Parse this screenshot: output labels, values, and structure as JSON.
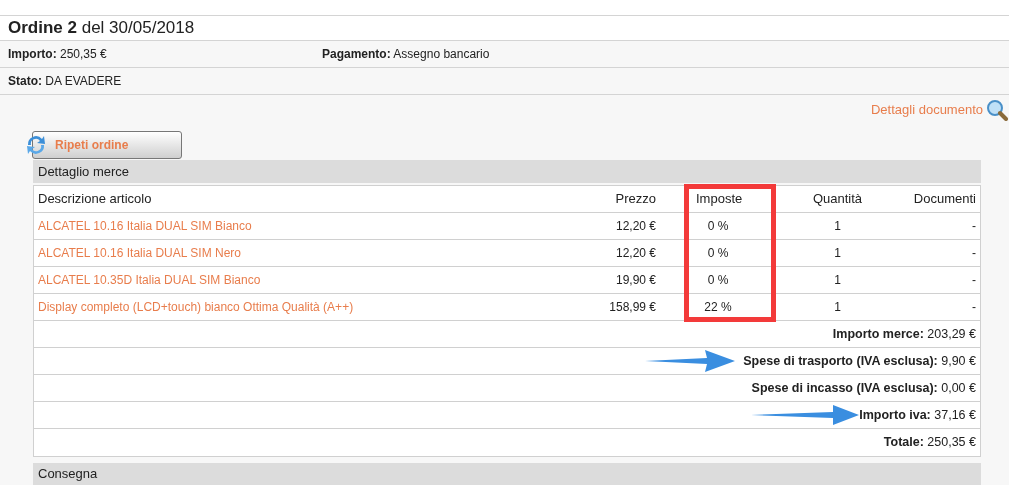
{
  "header": {
    "title": "Ordine 2",
    "date": "del 30/05/2018"
  },
  "info": [
    {
      "label": "Importo:",
      "value": "250,35 €"
    },
    {
      "label": "Pagamento:",
      "value": "Assegno bancario"
    },
    {
      "label": "Stato:",
      "value": "DA EVADERE"
    }
  ],
  "details_link": "Dettagli documento",
  "repeat_button": "Ripeti ordine",
  "section": "Dettaglio merce",
  "table": {
    "columns": [
      {
        "label": "Descrizione articolo",
        "highlighted": false
      },
      {
        "label": "Prezzo",
        "highlighted": false
      },
      {
        "label": "Imposte",
        "highlighted": true
      },
      {
        "label": "Quantità",
        "highlighted": false
      },
      {
        "label": "Documenti",
        "highlighted": false
      }
    ],
    "rows": [
      [
        "ALCATEL 10.16 Italia DUAL SIM Bianco",
        "12,20 €",
        "0 %",
        "1",
        "-"
      ],
      [
        "ALCATEL 10.16 Italia DUAL SIM Nero",
        "12,20 €",
        "0 %",
        "1",
        "-"
      ],
      [
        "ALCATEL 10.35D Italia DUAL SIM Bianco",
        "19,90 €",
        "0 %",
        "1",
        "-"
      ],
      [
        "Display completo (LCD+touch) bianco Ottima Qualità (A++)",
        "158,99 €",
        "22 %",
        "1",
        "-"
      ]
    ]
  },
  "summary": [
    {
      "label": "Importo merce:",
      "value": "203,29 €",
      "arrow": false
    },
    {
      "label": "Spese di trasporto (IVA esclusa):",
      "value": "9,90 €",
      "arrow": true
    },
    {
      "label": "Spese di incasso (IVA esclusa):",
      "value": "0,00 €",
      "arrow": false
    },
    {
      "label": "Importo iva:",
      "value": "37,16 €",
      "arrow": true
    },
    {
      "label": "Totale:",
      "value": "250,35 €",
      "arrow": false
    }
  ],
  "next_section": "Consegna"
}
